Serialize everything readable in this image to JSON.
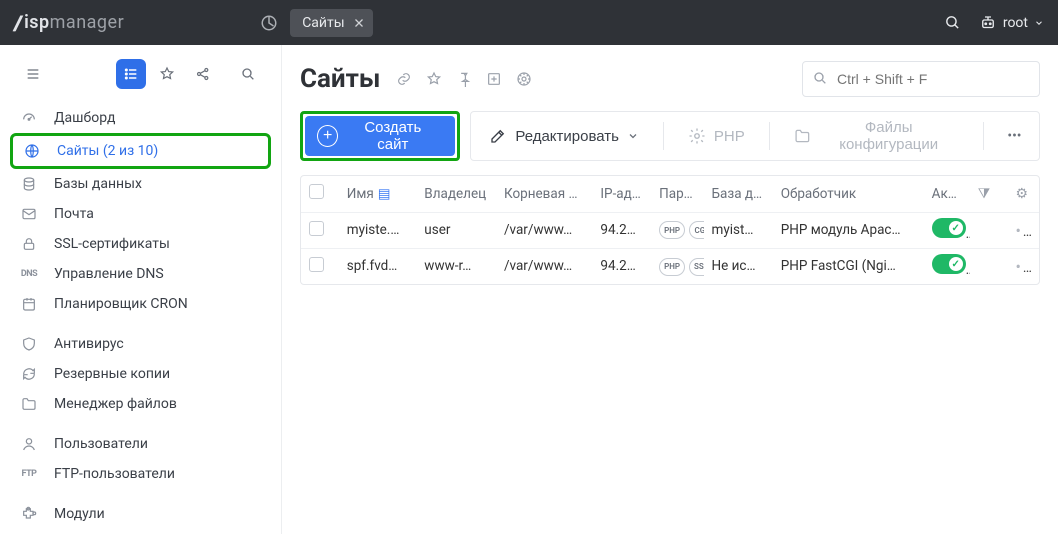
{
  "brand": {
    "prefix": "isp",
    "suffix": "manager"
  },
  "topbar": {
    "tab_label": "Сайты",
    "user_label": "root"
  },
  "sidebar": {
    "items": [
      {
        "label": "Дашборд",
        "icon": "gauge"
      },
      {
        "label": "Сайты (2 из 10)",
        "icon": "globe",
        "active": true,
        "highlight": true
      },
      {
        "label": "Базы данных",
        "icon": "database"
      },
      {
        "label": "Почта",
        "icon": "mail"
      },
      {
        "label": "SSL-сертификаты",
        "icon": "lock"
      },
      {
        "label": "Управление DNS",
        "icon": "dns"
      },
      {
        "label": "Планировщик CRON",
        "icon": "calendar"
      }
    ],
    "items2": [
      {
        "label": "Антивирус",
        "icon": "shield"
      },
      {
        "label": "Резервные копии",
        "icon": "refresh"
      },
      {
        "label": "Менеджер файлов",
        "icon": "folder"
      }
    ],
    "items3": [
      {
        "label": "Пользователи",
        "icon": "user"
      },
      {
        "label": "FTP-пользователи",
        "icon": "ftp"
      }
    ],
    "items4": [
      {
        "label": "Модули",
        "icon": "puzzle"
      }
    ]
  },
  "page": {
    "title": "Сайты",
    "search_placeholder": "Ctrl + Shift + F",
    "toolbar": {
      "create_label": "Создать сайт",
      "edit_label": "Редактировать",
      "php_label": "PHP",
      "config_label": "Файлы конфигурации"
    }
  },
  "table": {
    "headers": {
      "name": "Имя",
      "owner": "Владелец",
      "root": "Корневая д…",
      "ip": "IP-ад…",
      "par": "Пар…",
      "db": "База д…",
      "handler": "Обработчик",
      "active": "Акт…"
    },
    "rows": [
      {
        "name": "myiste.…",
        "owner": "user",
        "root": "/var/www…",
        "ip": "94.2…",
        "b1": "PHP",
        "b2": "CGI",
        "db": "myist…",
        "handler": "PHP модуль Apac…",
        "active": true
      },
      {
        "name": "spf.fvd…",
        "owner": "www-r…",
        "root": "/var/www…",
        "ip": "94.2…",
        "b1": "PHP",
        "b2": "SSL",
        "db": "Не ис…",
        "handler": "PHP FastCGI (Ngi…",
        "active": true
      }
    ]
  }
}
